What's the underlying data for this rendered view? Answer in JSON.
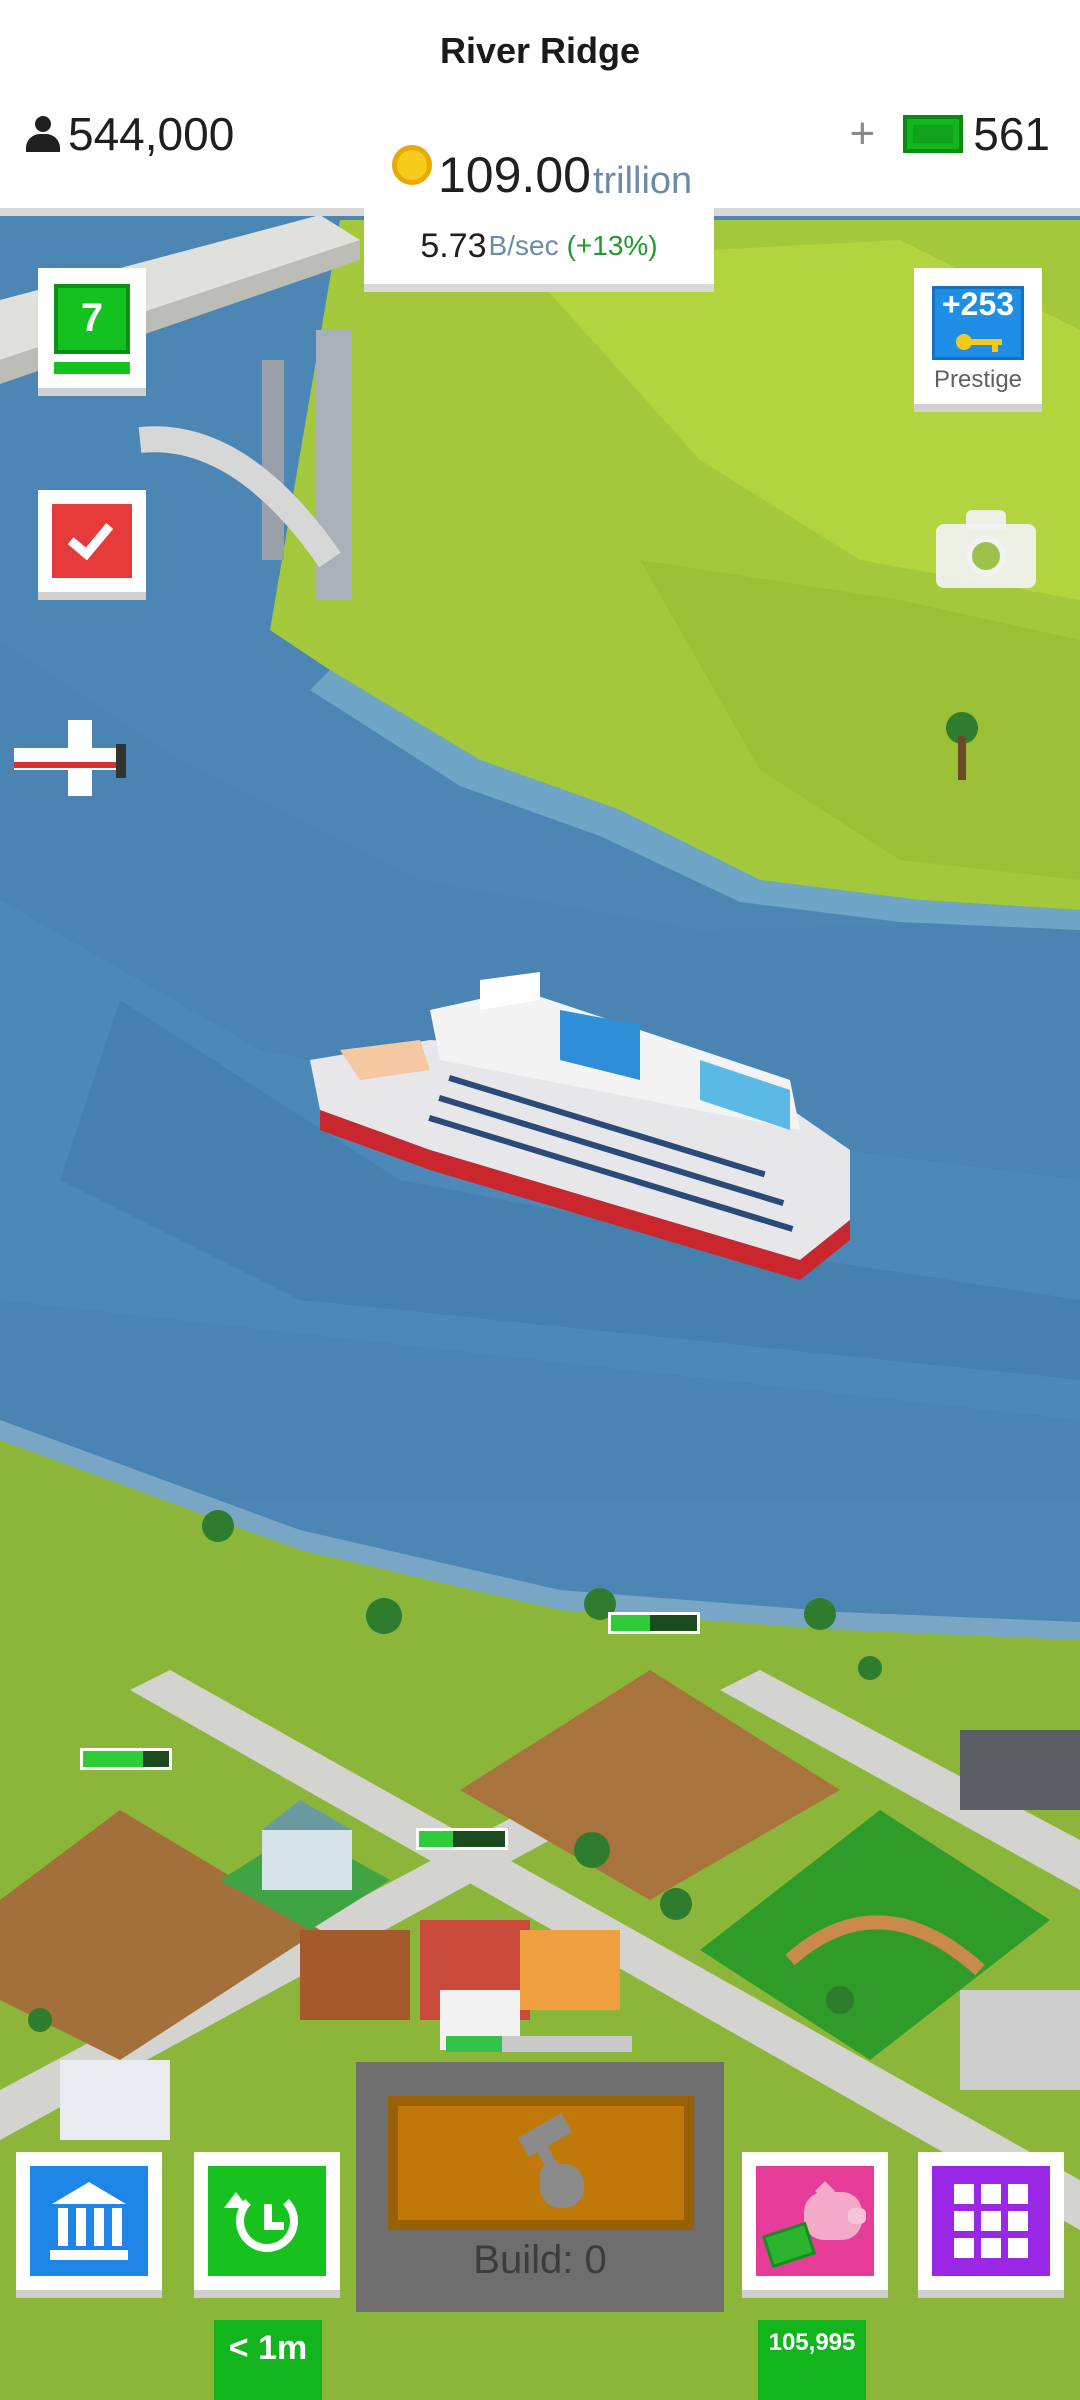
{
  "header": {
    "city_name": "River Ridge",
    "population": "544,000",
    "coins_value": "109.00",
    "coins_unit": "trillion",
    "cash_plus": "+",
    "cash_value": "561",
    "income_value": "5.73",
    "income_unit": "B/sec",
    "income_bonus": "(+13%)"
  },
  "side_buttons": {
    "level": "7",
    "level_progress": 1.0,
    "prestige_amount": "+253",
    "prestige_label": "Prestige"
  },
  "scene_progress": [
    {
      "name": "building-progress-north",
      "fraction": 0.45
    },
    {
      "name": "building-progress-west",
      "fraction": 0.7
    },
    {
      "name": "building-progress-center",
      "fraction": 0.4
    }
  ],
  "bottom_bar": {
    "boost_timer": "< 1m",
    "piggy_value": "105,995",
    "build_label": "Build: 0",
    "build_progress": 0.3
  },
  "colors": {
    "river": "#4b86b4",
    "grass": "#9cc43a",
    "bank": "#1f85e6",
    "boost": "#17c21e",
    "piggy": "#e63c9a",
    "menu": "#9b27e6",
    "build_slot": "#c07908"
  },
  "icons": {
    "population": "person-icon",
    "coins": "coin-icon",
    "cash": "cash-bill-icon",
    "tasks": "checkmark-icon",
    "prestige": "key-icon",
    "camera": "camera-icon",
    "bank": "bank-icon",
    "boost": "clock-refresh-icon",
    "piggy": "piggy-bank-icon",
    "menu": "grid-icon",
    "build": "hammer-icon"
  }
}
